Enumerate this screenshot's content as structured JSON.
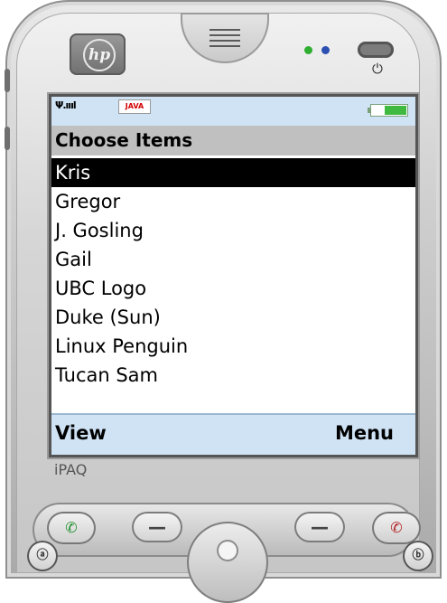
{
  "device": {
    "logo_text": "hp",
    "brand_label": "iPAQ",
    "power_symbol": "⏻",
    "colors": {
      "led_green": "#2fae2f",
      "led_blue": "#2b4fb3"
    }
  },
  "status": {
    "signal_text": "Ψ.ıııl",
    "java_badge": "JAVA",
    "battery_level_percent": 60
  },
  "screen": {
    "title": "Choose Items",
    "items": [
      {
        "label": "Kris",
        "selected": true
      },
      {
        "label": "Gregor",
        "selected": false
      },
      {
        "label": "J. Gosling",
        "selected": false
      },
      {
        "label": "Gail",
        "selected": false
      },
      {
        "label": "UBC Logo",
        "selected": false
      },
      {
        "label": "Duke (Sun)",
        "selected": false
      },
      {
        "label": "Linux Penguin",
        "selected": false
      },
      {
        "label": "Tucan Sam",
        "selected": false
      }
    ],
    "softkeys": {
      "left": "View",
      "right": "Menu"
    }
  },
  "buttons": {
    "call_icon": "phone-icon",
    "end_icon": "end-call-icon",
    "minus": "—",
    "left_round_label": "ⓐ",
    "right_round_label": "ⓑ"
  }
}
